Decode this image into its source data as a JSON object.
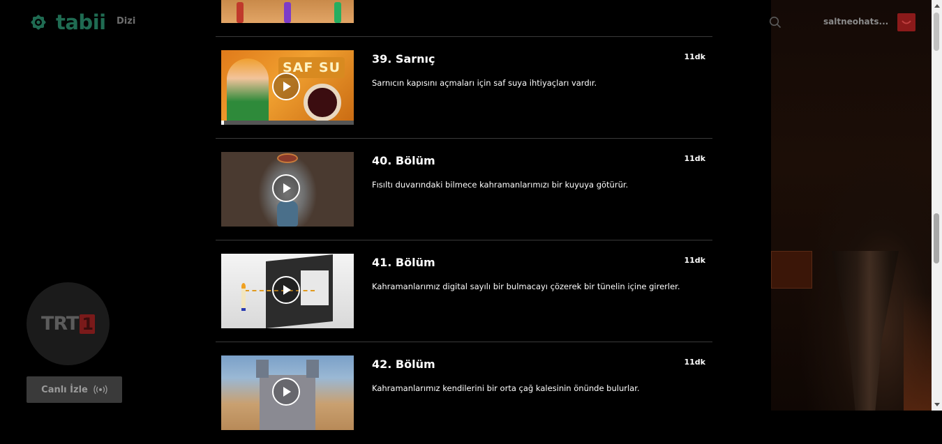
{
  "header": {
    "logo_text": "tabii",
    "nav_dizi": "Dizi",
    "username": "saltneohats..."
  },
  "live": {
    "channel_logo": "TRT",
    "channel_num": "1",
    "button_label": "Canlı İzle"
  },
  "episodes": [
    {
      "title": "39. Sarnıç",
      "duration": "11dk",
      "description": "Sarnıcın kapısını açmaları için saf suya ihtiyaçları vardır.",
      "thumb_text": "SAF SU",
      "watched_progress": 0.02
    },
    {
      "title": "40. Bölüm",
      "duration": "11dk",
      "description": "Fısıltı duvarındaki bilmece kahramanlarımızı bir kuyuya götürür."
    },
    {
      "title": "41. Bölüm",
      "duration": "11dk",
      "description": "Kahramanlarımız digital sayılı bir bulmacayı çözerek bir tünelin içine girerler."
    },
    {
      "title": "42. Bölüm",
      "duration": "11dk",
      "description": "Kahramanlarımız kendilerini bir orta çağ kalesinin önünde bulurlar."
    }
  ],
  "colors": {
    "background": "#000000",
    "brand": "#1f6b52",
    "divider": "#3a3a3a",
    "live_button": "#3a3a3a"
  },
  "icons": [
    "tabii-logo-icon",
    "search-icon",
    "avatar-icon",
    "play-icon",
    "live-broadcast-icon"
  ]
}
